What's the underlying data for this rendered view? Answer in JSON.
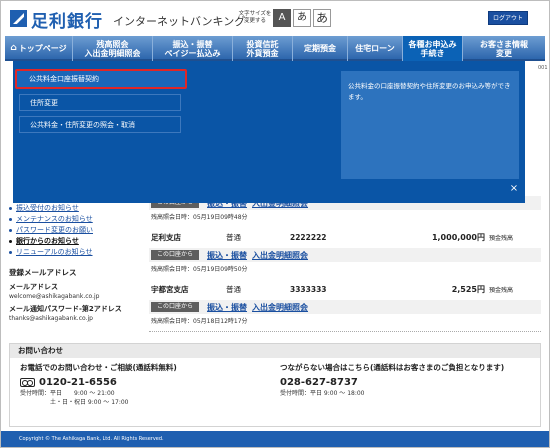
{
  "header": {
    "logo_text": "足利銀行",
    "logo_sub": "インターネットバンキング",
    "fontsize_label": "文字サイズを\n変更する",
    "fontsize_options": [
      "A",
      "あ",
      "あ"
    ],
    "logout_label": "ログアウト"
  },
  "nav": {
    "items": [
      {
        "label": "トップページ"
      },
      {
        "label": "残高照会\n入出金明細照会"
      },
      {
        "label": "振込・振替\nペイジー払込み"
      },
      {
        "label": "投資信託\n外貨預金"
      },
      {
        "label": "定期預金"
      },
      {
        "label": "住宅ローン"
      },
      {
        "label": "各種お申込み\n手続き"
      },
      {
        "label": "お客さま情報\n変更"
      }
    ]
  },
  "dropdown": {
    "items": [
      {
        "label": "公共料金口座振替契約"
      },
      {
        "label": "住所変更"
      },
      {
        "label": "公共料金・住所変更の照会・取消"
      }
    ],
    "description": "公共料金の口座振替契約や住所変更のお申込み等ができます。",
    "close_label": "×"
  },
  "page_marker": "001",
  "sidebar": {
    "links": [
      "振込受付のお知らせ",
      "メンテナンスのお知らせ",
      "パスワード変更のお願い",
      "銀行からのお知らせ",
      "リニューアルのお知らせ"
    ],
    "reg_title": "登録メールアドレス",
    "mail_label": "メールアドレス",
    "mail_value": "welcome@ashikagabank.co.jp",
    "notify_label": "メール通知パスワード-第2アドレス",
    "notify_value": "thanks@ashikagabank.co.jp"
  },
  "accounts": [
    {
      "tag": "この口座から",
      "link1": "振込・振替",
      "link2": "入出金明細照会",
      "date": "残高照会日時：05月19日09時48分",
      "branch": "",
      "type": "",
      "number": "",
      "amount": "",
      "amount_label": ""
    },
    {
      "tag": "この口座から",
      "link1": "振込・振替",
      "link2": "入出金明細照会",
      "date": "残高照会日時：05月19日09時50分",
      "branch": "足利支店",
      "type": "普通",
      "number": "2222222",
      "amount": "1,000,000円",
      "amount_label": "預金残高"
    },
    {
      "tag": "この口座から",
      "link1": "振込・振替",
      "link2": "入出金明細照会",
      "date": "残高照会日時：05月18日12時17分",
      "branch": "宇都宮支店",
      "type": "普通",
      "number": "3333333",
      "amount": "2,525円",
      "amount_label": "預金残高"
    }
  ],
  "contact": {
    "heading": "お問い合わせ",
    "left_title": "お電話でのお問い合わせ・ご相談(通話料無料)",
    "left_tel": "0120-21-6556",
    "left_hours": "受付時間：平日　　9:00 ～ 21:00\n　　　　　土・日・祝日 9:00 ～ 17:00",
    "right_title": "つながらない場合はこちら(通話料はお客さまのご負担となります)",
    "right_tel": "028-627-8737",
    "right_hours": "受付時間：平日 9:00 ～ 18:00"
  },
  "footer": {
    "copyright": "Copyright © The Ashikaga Bank, Ltd. All Rights Reserved."
  },
  "colors": {
    "brand": "#1f5fb0",
    "dropdown_bg": "#0a55a6",
    "highlight_border": "#e12626"
  }
}
